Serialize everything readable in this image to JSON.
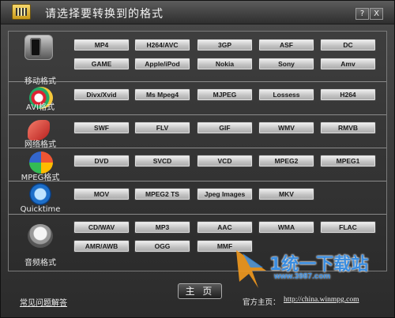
{
  "window": {
    "title": "请选择要转换到的格式",
    "help_label": "?",
    "close_label": "X"
  },
  "categories": [
    {
      "id": "mobile",
      "label": "移动格式",
      "icon": "mobile-phone-icon",
      "buttons": [
        [
          "MP4",
          "H264/AVC",
          "3GP",
          "ASF",
          "DC"
        ],
        [
          "GAME",
          "Apple/iPod",
          "Nokia",
          "Sony",
          "Amv"
        ]
      ]
    },
    {
      "id": "avi",
      "label": "AVI格式",
      "icon": "film-reel-icon",
      "buttons": [
        [
          "Divx/Xvid",
          "Ms Mpeg4",
          "MJPEG",
          "Lossess",
          "H264"
        ]
      ]
    },
    {
      "id": "web",
      "label": "网络格式",
      "icon": "flash-icon",
      "buttons": [
        [
          "SWF",
          "FLV",
          "GIF",
          "WMV",
          "RMVB"
        ]
      ]
    },
    {
      "id": "mpeg",
      "label": "MPEG格式",
      "icon": "mpeg-disc-icon",
      "buttons": [
        [
          "DVD",
          "SVCD",
          "VCD",
          "MPEG2",
          "MPEG1"
        ]
      ]
    },
    {
      "id": "quicktime",
      "label": "Quicktime",
      "icon": "quicktime-icon",
      "buttons": [
        [
          "MOV",
          "MPEG2 TS",
          "Jpeg Images",
          "MKV"
        ]
      ]
    },
    {
      "id": "audio",
      "label": "音频格式",
      "icon": "speaker-icon",
      "buttons": [
        [
          "CD/WAV",
          "MP3",
          "AAC",
          "WMA",
          "FLAC"
        ],
        [
          "AMR/AWB",
          "OGG",
          "MMF"
        ]
      ]
    }
  ],
  "footer": {
    "faq_label": "常见问题解答",
    "home_label": "主 页",
    "site_label": "官方主页：",
    "site_url": "http://china.winmpg.com"
  },
  "watermark": {
    "text": "1统一下载站",
    "sub": "www.3987.com"
  }
}
